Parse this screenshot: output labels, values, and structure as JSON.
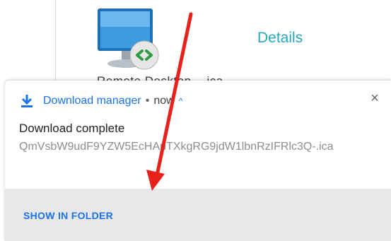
{
  "background": {
    "file_name": "Remote Desktop - .ica",
    "details_link": "Details"
  },
  "notification": {
    "app_name": "Download manager",
    "separator": "•",
    "time": "now",
    "expand_glyph": "^",
    "close_glyph": "×",
    "title": "Download complete",
    "file_name": "QmVsbW9udF9YZW5EcHAuTXkgRG9jdW1lbnRzIFRlc3Q-.ica",
    "action_label": "SHOW IN FOLDER"
  },
  "icons": [
    "remote-desktop-icon",
    "download-icon",
    "chevron-up-icon",
    "close-icon"
  ],
  "annotation": {
    "arrow_color": "#e8221b"
  },
  "colors": {
    "accent": "#1a73e8",
    "details": "#29a9b8",
    "action_bar": "#e8e8e8"
  }
}
